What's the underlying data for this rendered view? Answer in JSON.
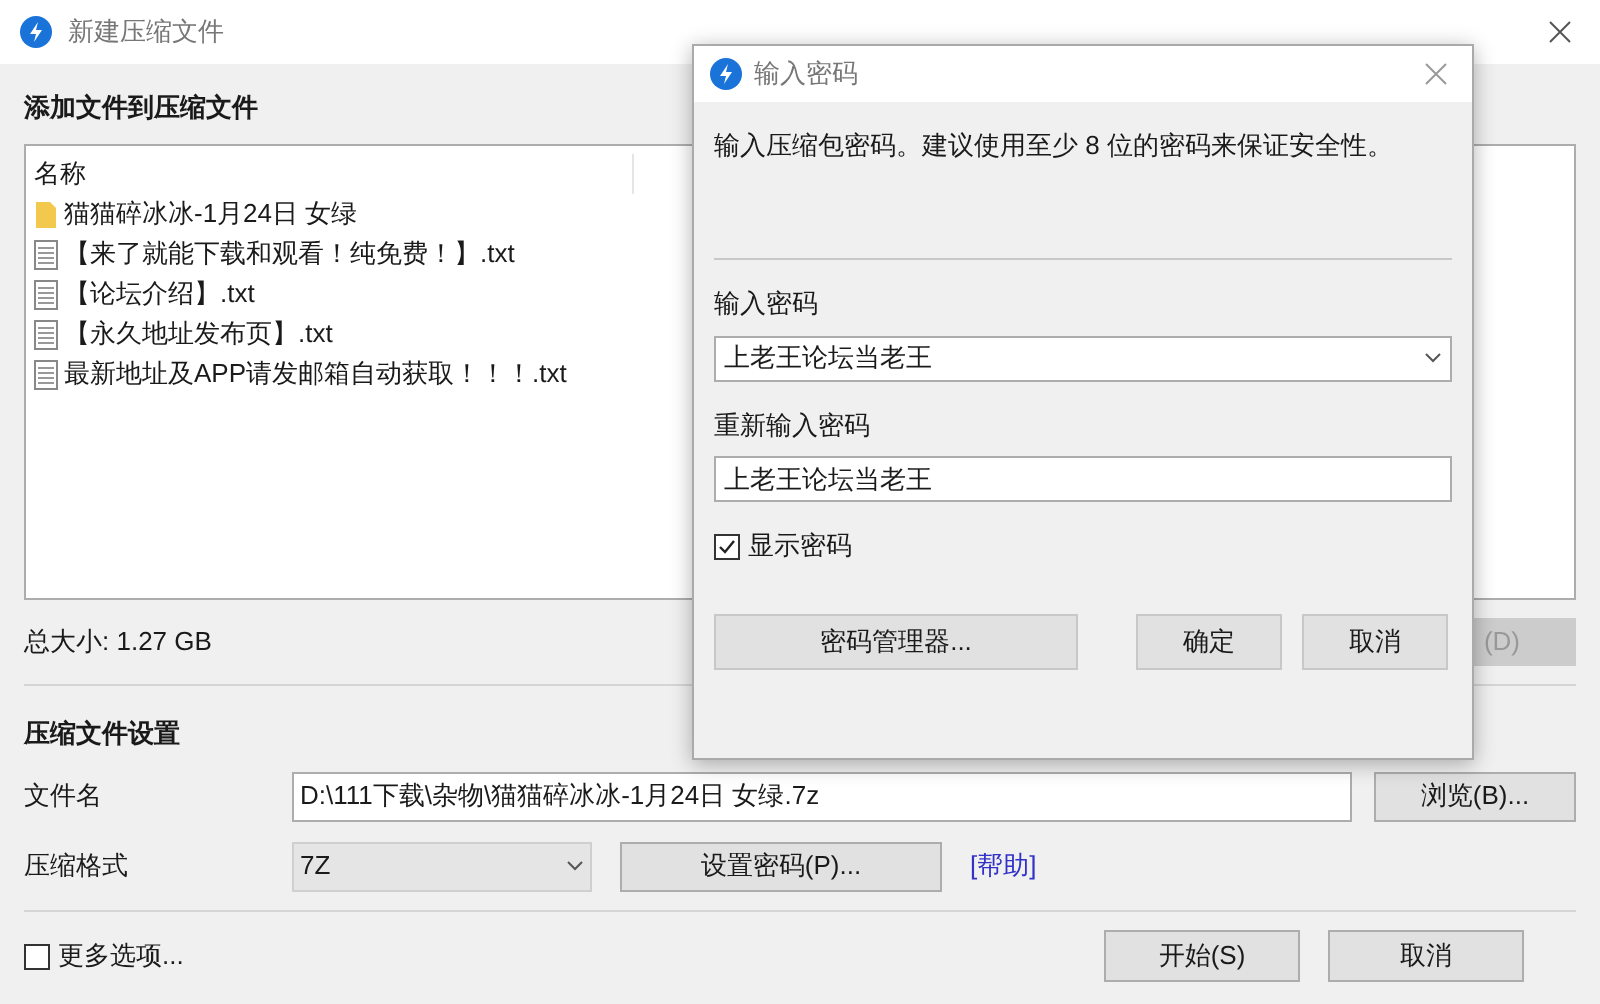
{
  "window": {
    "title": "新建压缩文件"
  },
  "files_section": {
    "title": "添加文件到压缩文件",
    "column": "名称",
    "files": [
      {
        "kind": "folder",
        "name": "猫猫碎冰冰-1月24日 女绿"
      },
      {
        "kind": "file",
        "name": "【来了就能下载和观看！纯免费！】.txt"
      },
      {
        "kind": "file",
        "name": "【论坛介绍】.txt"
      },
      {
        "kind": "file",
        "name": "【永久地址发布页】.txt"
      },
      {
        "kind": "file",
        "name": "最新地址及APP请发邮箱自动获取！！！.txt"
      }
    ],
    "total_size": "总大小: 1.27 GB",
    "delete_button": {
      "label": "(D)",
      "disabled": true
    }
  },
  "settings": {
    "title": "压缩文件设置",
    "filename_label": "文件名",
    "filename": "D:\\111下载\\杂物\\猫猫碎冰冰-1月24日 女绿.7z",
    "browse_button": "浏览(B)...",
    "format_label": "压缩格式",
    "format": "7Z",
    "password_button": "设置密码(P)...",
    "help_link": "[帮助]"
  },
  "footer": {
    "more_options": {
      "label": "更多选项...",
      "checked": false
    },
    "buttons": [
      "开始(S)",
      "取消"
    ]
  },
  "dialog": {
    "title": "输入密码",
    "message": "输入压缩包密码。建议使用至少 8 位的密码来保证安全性。",
    "password_label": "输入密码",
    "password": "上老王论坛当老王",
    "confirm_label": "重新输入密码",
    "confirm": "上老王论坛当老王",
    "show_password": {
      "label": "显示密码",
      "checked": true
    },
    "manager_button": "密码管理器...",
    "buttons": [
      "确定",
      "取消"
    ]
  }
}
